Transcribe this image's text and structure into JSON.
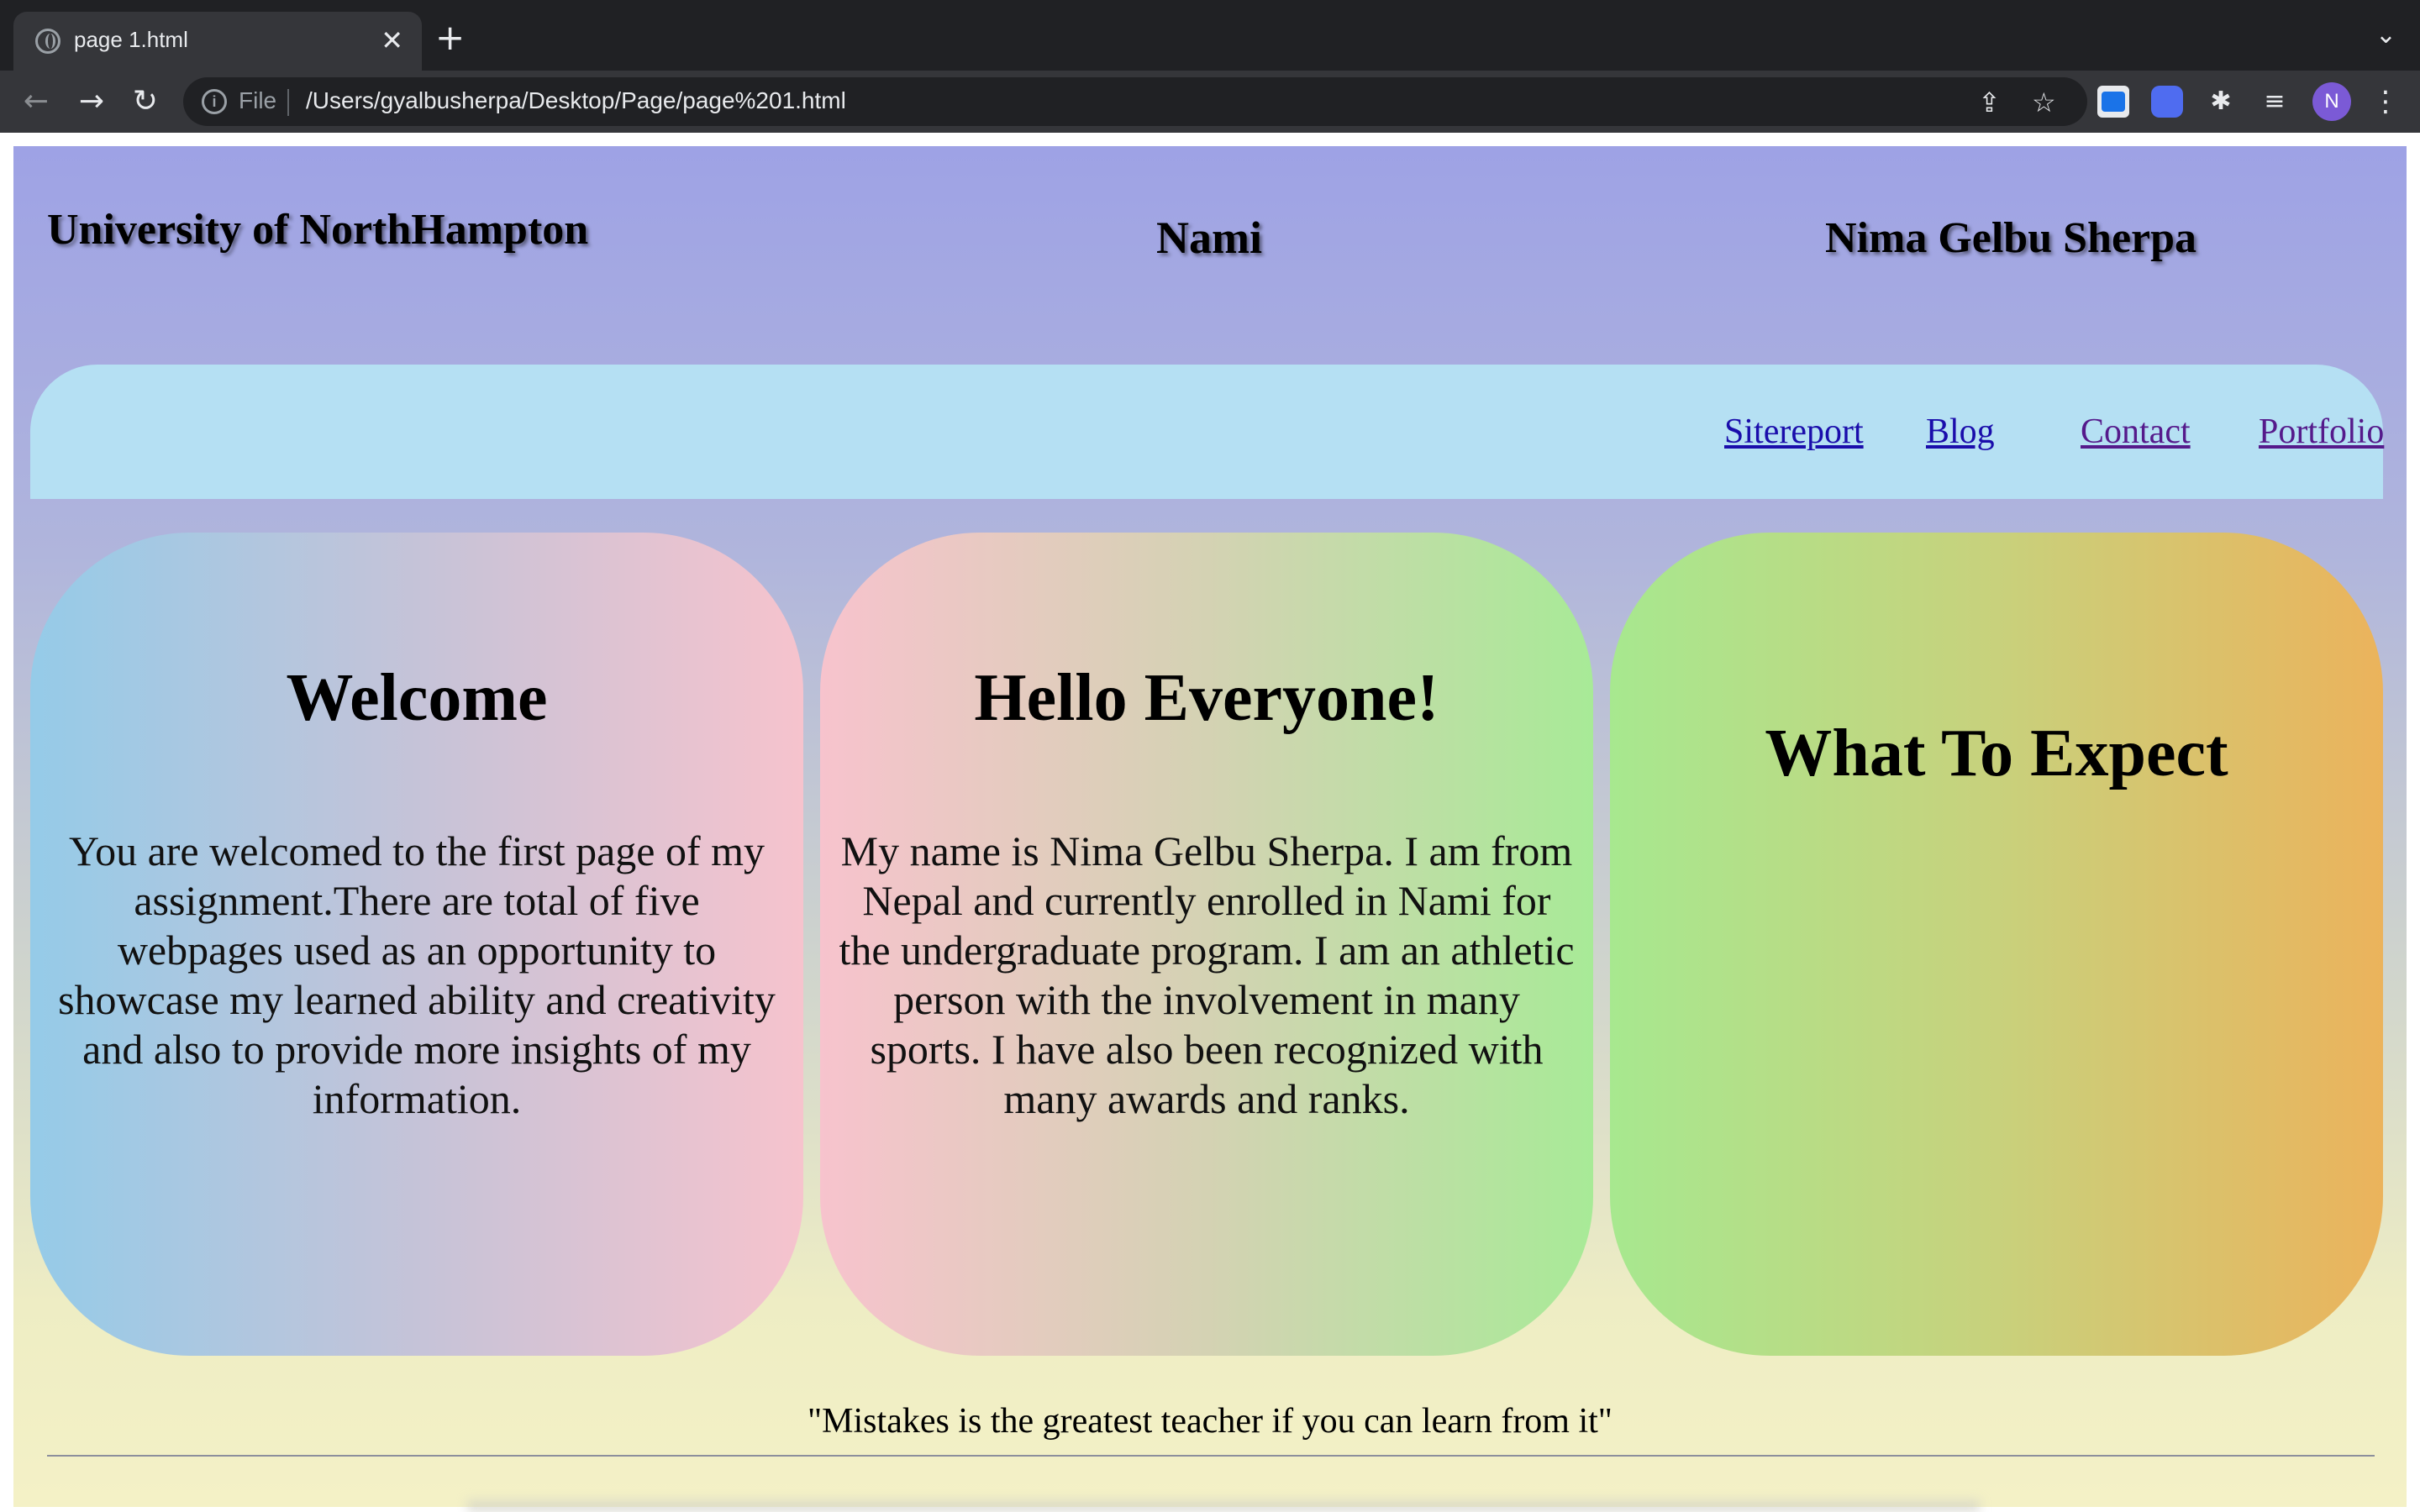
{
  "browser": {
    "tab_title": "page 1.html",
    "tab_close": "✕",
    "new_tab": "+",
    "tab_menu": "⌄",
    "back": "←",
    "forward": "→",
    "reload": "↻",
    "info_icon": "i",
    "scheme_label": "File",
    "url": "/Users/gyalbusherpa/Desktop/Page/page%201.html",
    "share": "⇪",
    "bookmark": "☆",
    "extensions": "✱",
    "reading_list": "≡",
    "profile_initial": "N",
    "menu": "⋮"
  },
  "header": {
    "university": "University of NorthHampton",
    "center": "Nami",
    "author": "Nima Gelbu Sherpa"
  },
  "nav": {
    "links": [
      "Sitereport",
      "Blog",
      "Contact",
      "Portfolio"
    ]
  },
  "cards": [
    {
      "title": "Welcome",
      "text": "You are welcomed to the first page of my assignment.There are total of five webpages used as an opportunity to showcase my learned ability and creativity and also to provide more insights of my information."
    },
    {
      "title": "Hello Everyone!",
      "text": "My name is Nima Gelbu Sherpa. I am from Nepal and currently enrolled in Nami for the undergraduate program. I am an athletic person with the involvement in many sports. I have also been recognized with many awards and ranks."
    },
    {
      "title": "What To Expect",
      "text": ""
    }
  ],
  "footer": {
    "quote": "\"Mistakes is the greatest teacher if you can learn from it\""
  },
  "colors": {
    "link": "#1a0dab",
    "visited_link": "#551a8b",
    "navbar": "#b5e0f3",
    "profile_avatar": "#7b5ad6"
  }
}
